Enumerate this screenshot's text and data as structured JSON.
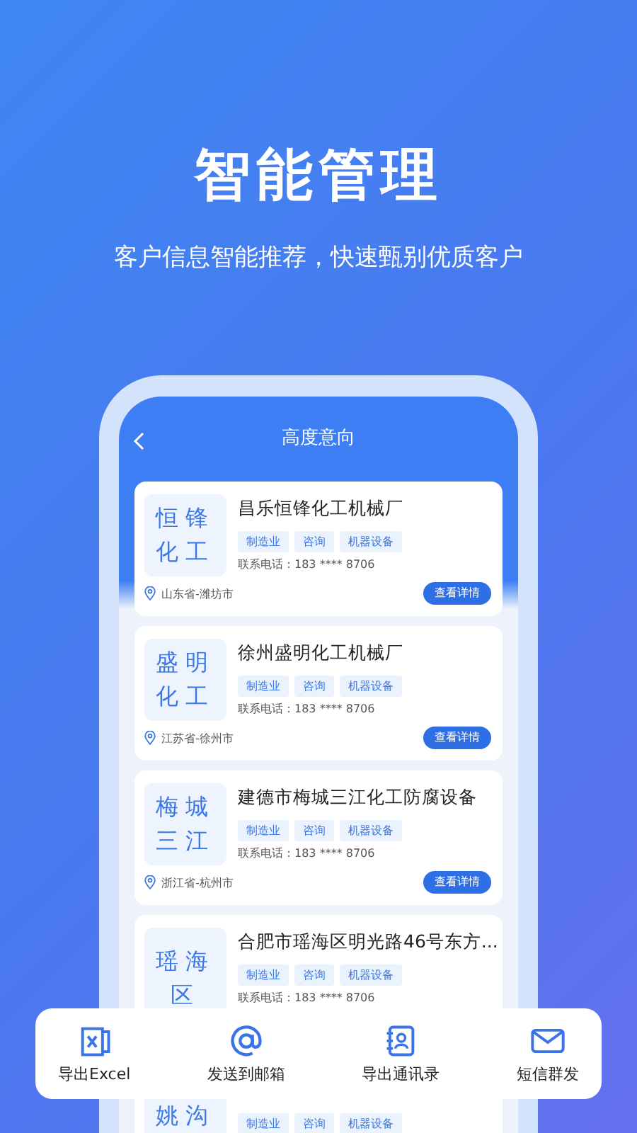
{
  "promo": {
    "title": "智能管理",
    "subtitle": "客户信息智能推荐，快速甄别优质客户"
  },
  "screen": {
    "header": {
      "back_icon": true,
      "title": "高度意向"
    },
    "customers": [
      {
        "logo_lines": [
          "恒锋",
          "化工"
        ],
        "name": "昌乐恒锋化工机械厂",
        "tags": [
          "制造业",
          "咨询",
          "机器设备"
        ],
        "phone": "联系电话：183 **** 8706",
        "location": "山东省-潍坊市",
        "button": "查看详情"
      },
      {
        "logo_lines": [
          "盛明",
          "化工"
        ],
        "name": "徐州盛明化工机械厂",
        "tags": [
          "制造业",
          "咨询",
          "机器设备"
        ],
        "phone": "联系电话：183 **** 8706",
        "location": "江苏省-徐州市",
        "button": "查看详情"
      },
      {
        "logo_lines": [
          "梅城",
          "三江"
        ],
        "name": "建德市梅城三江化工防腐设备",
        "tags": [
          "制造业",
          "咨询",
          "机器设备"
        ],
        "phone": "联系电话：183 **** 8706",
        "location": "浙江省-杭州市",
        "button": "查看详情"
      },
      {
        "logo_lines": [
          "瑶海",
          "区"
        ],
        "name": "合肥市瑶海区明光路46号东方...",
        "tags": [
          "制造业",
          "咨询",
          "机器设备"
        ],
        "phone": "联系电话：183 **** 8706"
      },
      {
        "logo_lines": [
          "姚沟"
        ],
        "tags": [
          "制造业",
          "咨询",
          "机器设备"
        ]
      }
    ]
  },
  "action_bar": [
    {
      "kind": "excel",
      "label": "导出Excel"
    },
    {
      "kind": "email",
      "label": "发送到邮箱"
    },
    {
      "kind": "contacts",
      "label": "导出通讯录"
    },
    {
      "kind": "sms",
      "label": "短信群发"
    }
  ]
}
